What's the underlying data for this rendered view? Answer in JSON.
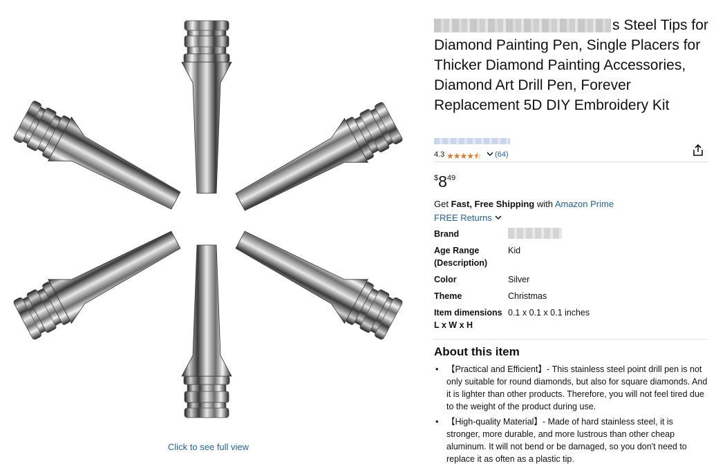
{
  "product": {
    "title_visible": "s Steel Tips for Diamond Painting Pen, Single Placers for Thicker Diamond Painting Accessories, Diamond Art Drill Pen, Forever Replacement 5D DIY Embroidery Kit",
    "rating": "4.3",
    "stars": "★★★★⯪",
    "review_count": "(64)",
    "price_symbol": "$",
    "price_whole": "8",
    "price_fraction": "49",
    "shipping_prefix": "Get ",
    "shipping_bold": "Fast, Free Shipping",
    "shipping_mid": " with ",
    "shipping_link": "Amazon Prime",
    "returns": "FREE Returns"
  },
  "gallery": {
    "full_view_link": "Click to see full view"
  },
  "specs": [
    {
      "key": "Brand",
      "value": ""
    },
    {
      "key": "Age Range (Description)",
      "value": "Kid"
    },
    {
      "key": "Color",
      "value": "Silver"
    },
    {
      "key": "Theme",
      "value": "Christmas"
    },
    {
      "key": "Item dimensions L x W x H",
      "value": "0.1 x 0.1 x 0.1 inches"
    }
  ],
  "about": {
    "heading": "About this item",
    "bullets": [
      "【Practical and Efficient】- This stainless steel point drill pen is not only suitable for round diamonds, but also for square diamonds. And it is lighter than other products. Therefore, you will not feel tired due to the weight of the product during use.",
      "【High-quality Material】- Made of hard stainless steel, it is stronger, more durable, and more lustrous than other cheap aluminum. It will not bend or be damaged, so you don't need to replace it as often as a plastic tip."
    ]
  },
  "icons": {
    "share": "share-icon",
    "chevron": "chevron-down-icon"
  },
  "colors": {
    "link": "#2162a1",
    "star": "#de7921",
    "text": "#0f1111"
  }
}
